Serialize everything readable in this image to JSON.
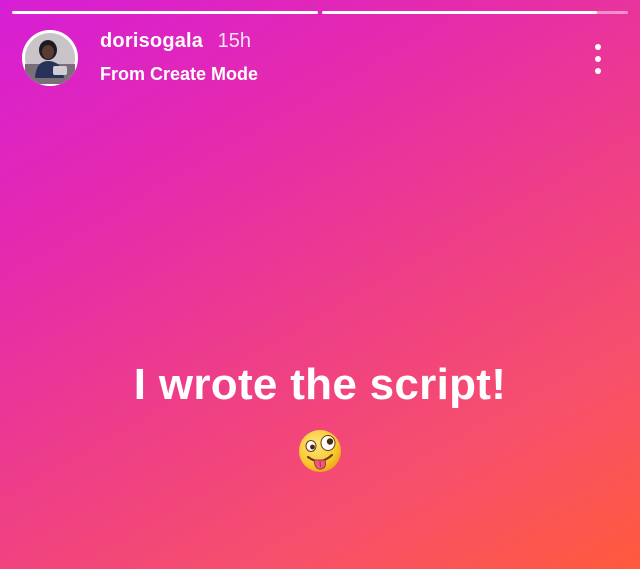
{
  "story": {
    "progress": [
      1.0,
      0.9
    ],
    "username": "dorisogala",
    "time_ago": "15h",
    "subtitle": "From Create Mode",
    "caption": "I wrote the script!",
    "emoji_icon": "zany-face-icon",
    "more_icon": "more-vertical-icon",
    "gradient": [
      "#d61ed6",
      "#ee3f86",
      "#ff5a3c"
    ]
  }
}
